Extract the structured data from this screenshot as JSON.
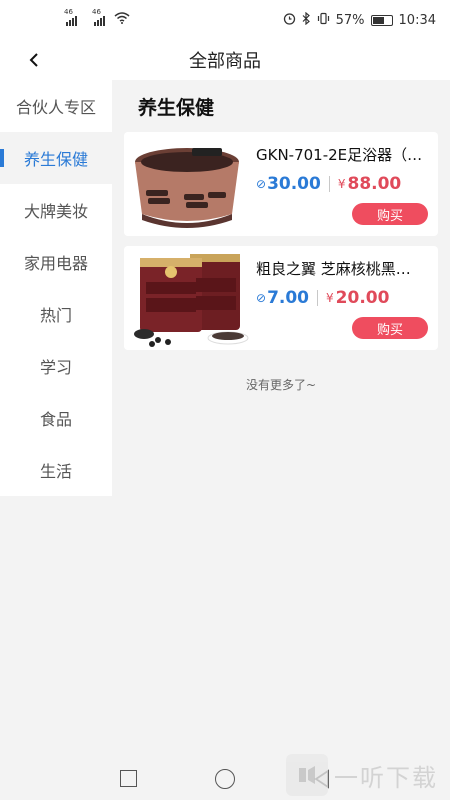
{
  "status_bar": {
    "signal1_tag": "46",
    "signal2_tag": "46",
    "battery": "57%",
    "time": "10:34"
  },
  "header": {
    "title": "全部商品"
  },
  "sidebar": {
    "items": [
      {
        "label": "合伙人专区"
      },
      {
        "label": "养生保健"
      },
      {
        "label": "大牌美妆"
      },
      {
        "label": "家用电器"
      },
      {
        "label": "热门"
      },
      {
        "label": "学习"
      },
      {
        "label": "食品"
      },
      {
        "label": "生活"
      }
    ]
  },
  "content": {
    "section_title": "养生保健",
    "products": [
      {
        "title": "GKN-701-2E足浴器（…",
        "member_price": "30.00",
        "price_symbol": "¥",
        "price": "88.00",
        "buy_label": "购买"
      },
      {
        "title": "粗良之翼 芝麻核桃黑…",
        "member_price": "7.00",
        "price_symbol": "¥",
        "price": "20.00",
        "buy_label": "购买"
      }
    ],
    "no_more": "没有更多了~"
  },
  "watermark": {
    "text": "一听下载"
  },
  "colors": {
    "accent": "#2a7ad6",
    "price_red": "#e04a5a",
    "buy_button": "#ef4d5f"
  }
}
